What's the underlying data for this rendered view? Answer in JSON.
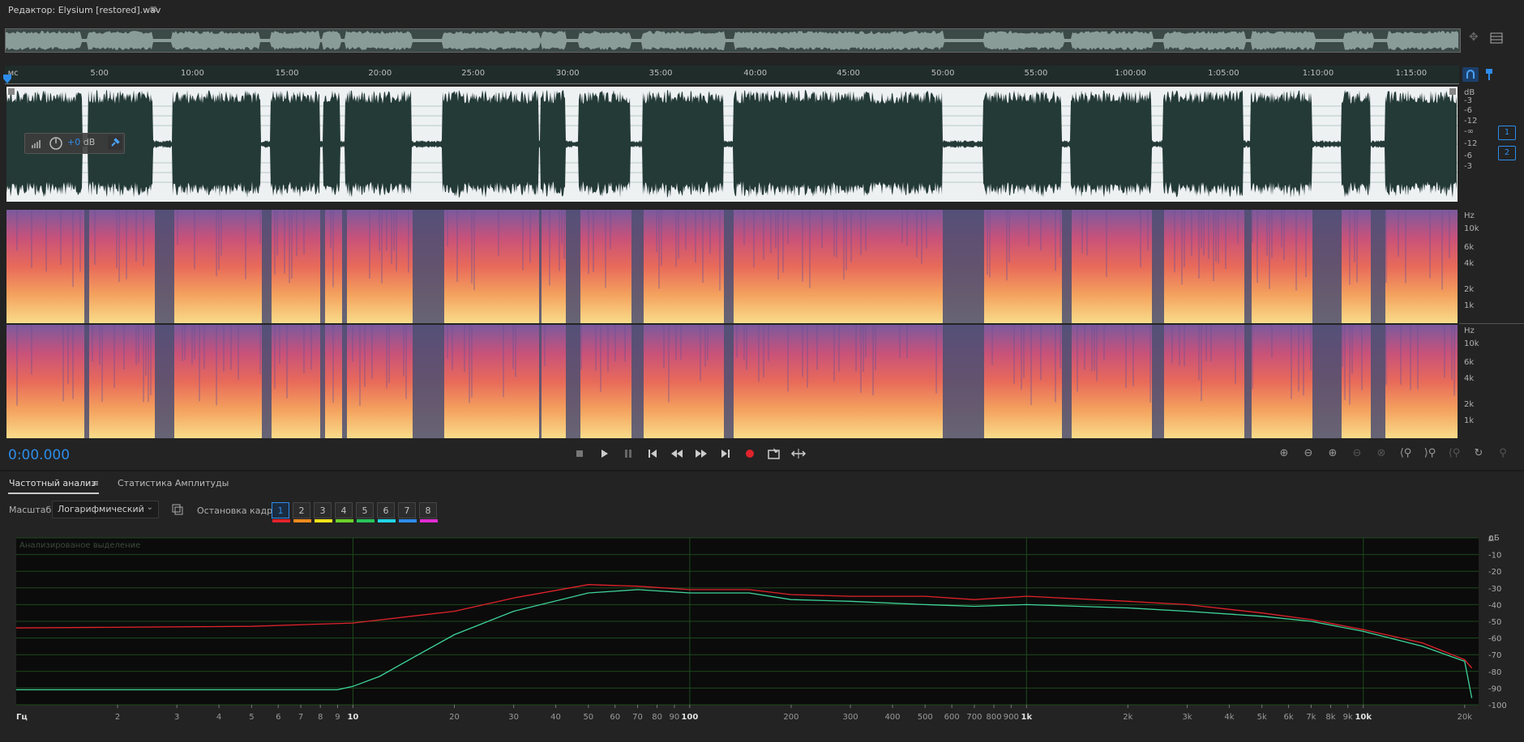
{
  "header": {
    "title": "Редактор: Elysium [restored].wav",
    "menu_icon": "≡"
  },
  "ruler": {
    "labels": [
      "мс",
      "5:00",
      "10:00",
      "15:00",
      "20:00",
      "25:00",
      "30:00",
      "35:00",
      "40:00",
      "45:00",
      "50:00",
      "55:00",
      "1:00:00",
      "1:05:00",
      "1:10:00",
      "1:15:00"
    ]
  },
  "waveform": {
    "db_scale": [
      "dB",
      "-3",
      "-6",
      "-12",
      "-∞",
      "-12",
      "-6",
      "-3"
    ],
    "channels": [
      "1",
      "2"
    ],
    "gain_hud": {
      "value": "+0",
      "unit": " dB"
    }
  },
  "spectrogram": {
    "hz_scale": [
      "Hz",
      "10k",
      "6k",
      "4k",
      "2k",
      "1k"
    ]
  },
  "transport": {
    "time": "0:00.000",
    "buttons": [
      "stop",
      "play",
      "pause",
      "to-start",
      "rewind",
      "fast-forward",
      "to-end",
      "record",
      "loop",
      "skip"
    ]
  },
  "panel": {
    "tabs": [
      {
        "label": "Частотный анализ",
        "active": true
      },
      {
        "label": "Статистика Амплитуды",
        "active": false
      }
    ],
    "scale_label": "Масштаб:",
    "scale_value": "Логарифмический",
    "freeze_label": "Остановка кадра:",
    "frames": [
      {
        "label": "1",
        "color": "#e0232b"
      },
      {
        "label": "2",
        "color": "#f08a1f"
      },
      {
        "label": "3",
        "color": "#f2e21b"
      },
      {
        "label": "4",
        "color": "#6cd12a"
      },
      {
        "label": "5",
        "color": "#27c35b"
      },
      {
        "label": "6",
        "color": "#21d4e5"
      },
      {
        "label": "7",
        "color": "#2d8ceb"
      },
      {
        "label": "8",
        "color": "#e02bd1"
      }
    ]
  },
  "chart_data": {
    "type": "line",
    "title": "Анализированое выделение",
    "xlabel": "Гц",
    "ylabel": "дБ",
    "x_scale": "log",
    "xlim": [
      1,
      22000
    ],
    "ylim": [
      -100,
      0
    ],
    "x_ticks": [
      {
        "v": 2,
        "t": "2"
      },
      {
        "v": 3,
        "t": "3"
      },
      {
        "v": 4,
        "t": "4"
      },
      {
        "v": 5,
        "t": "5"
      },
      {
        "v": 6,
        "t": "6"
      },
      {
        "v": 7,
        "t": "7"
      },
      {
        "v": 8,
        "t": "8"
      },
      {
        "v": 9,
        "t": "9"
      },
      {
        "v": 10,
        "t": "10"
      },
      {
        "v": 20,
        "t": "20"
      },
      {
        "v": 30,
        "t": "30"
      },
      {
        "v": 40,
        "t": "40"
      },
      {
        "v": 50,
        "t": "50"
      },
      {
        "v": 60,
        "t": "60"
      },
      {
        "v": 70,
        "t": "70"
      },
      {
        "v": 80,
        "t": "80"
      },
      {
        "v": 90,
        "t": "90"
      },
      {
        "v": 100,
        "t": "100"
      },
      {
        "v": 200,
        "t": "200"
      },
      {
        "v": 300,
        "t": "300"
      },
      {
        "v": 400,
        "t": "400"
      },
      {
        "v": 500,
        "t": "500"
      },
      {
        "v": 600,
        "t": "600"
      },
      {
        "v": 700,
        "t": "700"
      },
      {
        "v": 800,
        "t": "800"
      },
      {
        "v": 900,
        "t": "900"
      },
      {
        "v": 1000,
        "t": "1k"
      },
      {
        "v": 2000,
        "t": "2k"
      },
      {
        "v": 3000,
        "t": "3k"
      },
      {
        "v": 4000,
        "t": "4k"
      },
      {
        "v": 5000,
        "t": "5k"
      },
      {
        "v": 6000,
        "t": "6k"
      },
      {
        "v": 7000,
        "t": "7k"
      },
      {
        "v": 8000,
        "t": "8k"
      },
      {
        "v": 9000,
        "t": "9k"
      },
      {
        "v": 10000,
        "t": "10k"
      },
      {
        "v": 20000,
        "t": "20k"
      }
    ],
    "y_ticks": [
      0,
      -10,
      -20,
      -30,
      -40,
      -50,
      -60,
      -70,
      -80,
      -90,
      -100
    ],
    "series": [
      {
        "color": "#e0232b",
        "x": [
          1,
          5,
          10,
          20,
          30,
          50,
          70,
          100,
          150,
          200,
          300,
          500,
          700,
          1000,
          2000,
          3000,
          5000,
          7000,
          10000,
          15000,
          20000,
          21000
        ],
        "y": [
          -54,
          -53,
          -51,
          -44,
          -36,
          -28,
          -29,
          -31,
          -31,
          -34,
          -35,
          -35,
          -37,
          -35,
          -38,
          -40,
          -45,
          -49,
          -55,
          -63,
          -73,
          -78
        ]
      },
      {
        "color": "#3ed49b",
        "x": [
          1,
          5,
          9,
          10,
          12,
          15,
          20,
          30,
          50,
          70,
          100,
          150,
          200,
          300,
          500,
          700,
          1000,
          2000,
          3000,
          5000,
          7000,
          10000,
          15000,
          20000,
          21000
        ],
        "y": [
          -91,
          -91,
          -91,
          -89,
          -83,
          -72,
          -58,
          -44,
          -33,
          -31,
          -33,
          -33,
          -37,
          -38,
          -40,
          -41,
          -40,
          -42,
          -44,
          -47,
          -50,
          -56,
          -65,
          -74,
          -96
        ]
      }
    ]
  }
}
